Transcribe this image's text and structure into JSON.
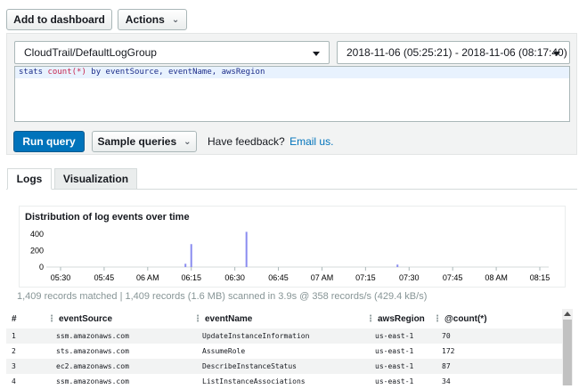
{
  "toolbar": {
    "add_dashboard": "Add to dashboard",
    "actions": "Actions"
  },
  "query": {
    "log_group": "CloudTrail/DefaultLogGroup",
    "time_range": "2018-11-06 (05:25:21) - 2018-11-06 (08:17:40)",
    "code_kw1": "stats ",
    "code_fn": "count(*)",
    "code_rest": " by eventSource, eventName, awsRegion",
    "run": "Run query",
    "sample": "Sample queries",
    "feedback": "Have feedback?",
    "email": "Email us."
  },
  "tabs": {
    "logs": "Logs",
    "visualization": "Visualization"
  },
  "colors": {
    "primary": "#0073bb",
    "bar": "#8a8cf0",
    "link": "#0073bb"
  },
  "chart_data": {
    "type": "bar",
    "title": "Distribution of log events over time",
    "x": [
      "06:13",
      "06:15",
      "06:34",
      "07:26"
    ],
    "values": [
      40,
      280,
      430,
      30
    ],
    "x_ticks": [
      "05:30",
      "05:45",
      "06 AM",
      "06:15",
      "06:30",
      "06:45",
      "07 AM",
      "07:15",
      "07:30",
      "07:45",
      "08 AM",
      "08:15"
    ],
    "y_ticks": [
      "400",
      "200",
      "0"
    ],
    "ylim": [
      0,
      500
    ],
    "grid": false
  },
  "summary": "1,409 records matched | 1,409 records (1.6 MB) scanned in 3.9s @ 358 records/s (429.4 kB/s)",
  "table": {
    "headers": [
      "#",
      "eventSource",
      "eventName",
      "awsRegion",
      "@count(*)"
    ],
    "rows": [
      [
        "1",
        "ssm.amazonaws.com",
        "UpdateInstanceInformation",
        "us-east-1",
        "70"
      ],
      [
        "2",
        "sts.amazonaws.com",
        "AssumeRole",
        "us-east-1",
        "172"
      ],
      [
        "3",
        "ec2.amazonaws.com",
        "DescribeInstanceStatus",
        "us-east-1",
        "87"
      ],
      [
        "4",
        "ssm.amazonaws.com",
        "ListInstanceAssociations",
        "us-east-1",
        "34"
      ]
    ]
  }
}
